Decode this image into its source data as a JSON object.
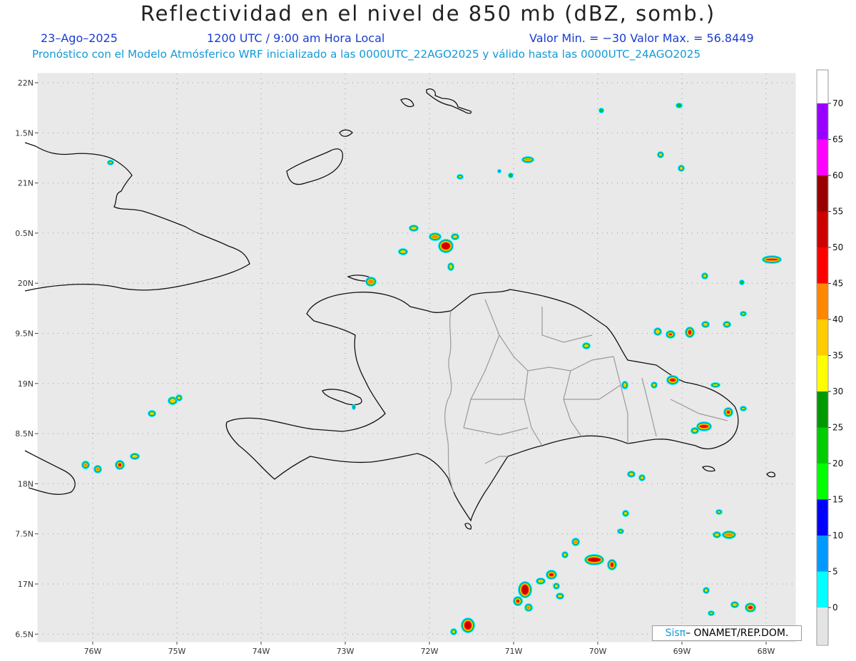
{
  "header": {
    "title": "Reflectividad en el nivel de 850 mb (dBZ, somb.)",
    "date": "23–Ago–2025",
    "time": "1200 UTC / 9:00 am Hora Local",
    "min_max": "Valor Min. = −30   Valor Max. = 56.8449",
    "model_line": "Pronóstico con el Modelo Atmósferico WRF inicializado a las 0000UTC_22AGO2025 y válido hasta las  0000UTC_24AGO2025"
  },
  "map": {
    "lon_min": -76.7,
    "lon_max": -67.6,
    "lat_min": 16.4,
    "lat_max": 22.1,
    "lat_ticks": [
      {
        "v": 22.0,
        "label": "22N"
      },
      {
        "v": 21.5,
        "label": "1.5N"
      },
      {
        "v": 21.0,
        "label": "21N"
      },
      {
        "v": 20.5,
        "label": "0.5N"
      },
      {
        "v": 20.0,
        "label": "20N"
      },
      {
        "v": 19.5,
        "label": "9.5N"
      },
      {
        "v": 19.0,
        "label": "19N"
      },
      {
        "v": 18.5,
        "label": "8.5N"
      },
      {
        "v": 18.0,
        "label": "18N"
      },
      {
        "v": 17.5,
        "label": "7.5N"
      },
      {
        "v": 17.0,
        "label": "17N"
      },
      {
        "v": 16.5,
        "label": "6.5N"
      }
    ],
    "lon_ticks": [
      {
        "v": -76,
        "label": "76W"
      },
      {
        "v": -75,
        "label": "75W"
      },
      {
        "v": -74,
        "label": "74W"
      },
      {
        "v": -73,
        "label": "73W"
      },
      {
        "v": -72,
        "label": "72W"
      },
      {
        "v": -71,
        "label": "71W"
      },
      {
        "v": -70,
        "label": "70W"
      },
      {
        "v": -69,
        "label": "69W"
      },
      {
        "v": -68,
        "label": "68W"
      }
    ],
    "background_color": "#e9e9e9"
  },
  "colorbar": {
    "labels": [
      "0",
      "5",
      "10",
      "15",
      "20",
      "25",
      "30",
      "35",
      "40",
      "45",
      "50",
      "55",
      "60",
      "65",
      "70"
    ],
    "colors": [
      "#00ffff",
      "#0099ff",
      "#0000ff",
      "#00ff00",
      "#00cc00",
      "#009900",
      "#ffff00",
      "#ffcc00",
      "#ff8800",
      "#ff0000",
      "#cc0000",
      "#990000",
      "#ff00ff",
      "#9900ff"
    ]
  },
  "credit": {
    "pi": "Sisπ",
    "text": " – ONAMET/REP.DOM."
  }
}
